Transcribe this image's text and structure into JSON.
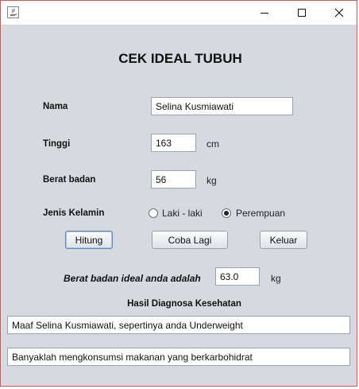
{
  "window": {
    "icon": "java-cup-icon",
    "controls": [
      "minimize-icon",
      "maximize-icon",
      "close-icon"
    ]
  },
  "form": {
    "title": "CEK IDEAL TUBUH",
    "nama_label": "Nama",
    "nama_value": "Selina Kusmiawati",
    "tinggi_label": "Tinggi",
    "tinggi_value": "163",
    "tinggi_unit": "cm",
    "berat_label": "Berat badan",
    "berat_value": "56",
    "berat_unit": "kg",
    "gender_label": "Jenis Kelamin",
    "gender_options": [
      "Laki - laki",
      "Perempuan"
    ],
    "gender_selected": "Perempuan"
  },
  "buttons": {
    "hitung": "Hitung",
    "coba_lagi": "Coba Lagi",
    "keluar": "Keluar"
  },
  "result": {
    "ideal_label": "Berat badan ideal anda adalah",
    "ideal_value": "63.0",
    "ideal_unit": "kg",
    "diagnosis_title": "Hasil Diagnosa Kesehatan",
    "diagnosis_text": "Maaf Selina Kusmiawati, sepertinya anda Underweight",
    "advice_text": "Banyaklah mengkonsumsi makanan yang berkarbohidrat"
  },
  "colors": {
    "window_bg": "#d6d9df",
    "border_accent": "#d9534f"
  }
}
